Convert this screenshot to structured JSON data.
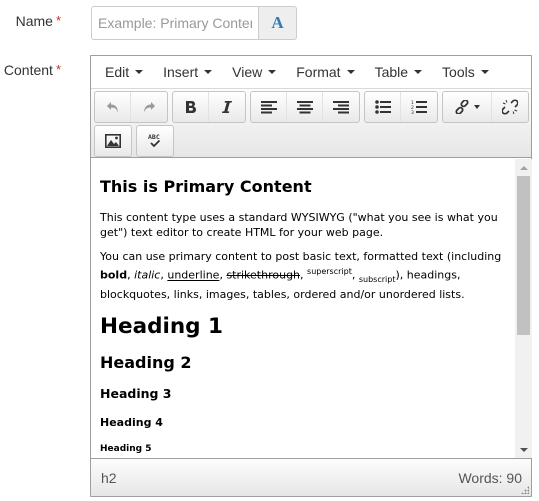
{
  "form": {
    "name_label": "Name",
    "content_label": "Content",
    "required_mark": "*",
    "name_placeholder": "Example: Primary Content",
    "name_value": "",
    "name_addon_icon": "A"
  },
  "editor": {
    "menubar": [
      {
        "label": "Edit"
      },
      {
        "label": "Insert"
      },
      {
        "label": "View"
      },
      {
        "label": "Format"
      },
      {
        "label": "Table"
      },
      {
        "label": "Tools"
      }
    ],
    "toolbar": {
      "buttons": [
        "undo-icon",
        "redo-icon",
        "bold-icon",
        "italic-icon",
        "align-left-icon",
        "align-center-icon",
        "align-right-icon",
        "bullet-list-icon",
        "numbered-list-icon",
        "link-icon",
        "unlink-icon",
        "image-icon",
        "spellcheck-icon"
      ],
      "spellcheck_glyph": "ABC"
    },
    "content": {
      "title": "This is Primary Content",
      "p1": "This content type uses a standard WYSIWYG (\"what you see is what you get\") text editor to create HTML for your web page.",
      "p2_start": "You can use primary content to post basic text, formatted text (including ",
      "bold": "bold",
      "italic": "italic",
      "underline": "underline",
      "strike": "strikethrough",
      "sup": "superscript",
      "sub": "subscript",
      "p2_end": "), headings, blockquotes, links, images, tables, ordered and/or unordered lists.",
      "sep": ", ",
      "h1": "Heading 1",
      "h2": "Heading 2",
      "h3": "Heading 3",
      "h4": "Heading 4",
      "h5": "Heading 5"
    },
    "statusbar": {
      "path": "h2",
      "word_count": "Words: 90"
    },
    "scroll_position_fraction": 0.0
  }
}
